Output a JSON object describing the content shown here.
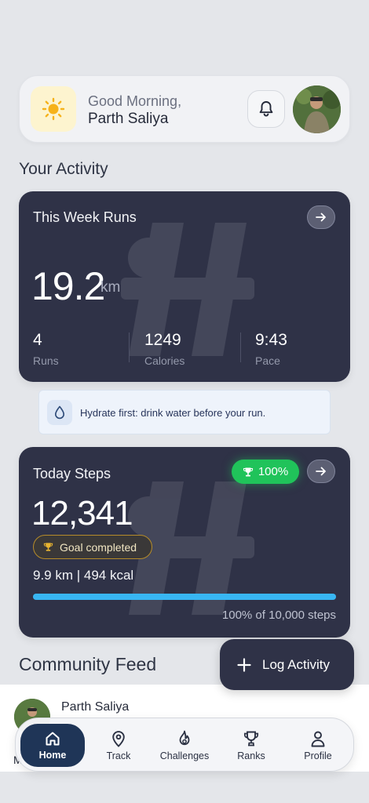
{
  "header": {
    "greeting": "Good Morning,",
    "user_name": "Parth Saliya",
    "weather_icon": "sun-icon",
    "notification_icon": "bell-icon"
  },
  "activity": {
    "section_title": "Your Activity",
    "week_runs": {
      "title": "This Week Runs",
      "distance": "19.2",
      "distance_unit": "km",
      "stats": [
        {
          "value": "4",
          "label": "Runs"
        },
        {
          "value": "1249",
          "label": "Calories"
        },
        {
          "value": "9:43",
          "label": "Pace"
        }
      ]
    }
  },
  "tip": {
    "text": "Hydrate first: drink water before your run.",
    "icon": "water-drop-icon"
  },
  "steps": {
    "title": "Today Steps",
    "percent_badge": "100%",
    "value": "12,341",
    "goal_label": "Goal completed",
    "meta": "9.9 km | 494 kcal",
    "progress_fraction": 1.0,
    "progress_text": "100% of 10,000 steps"
  },
  "community": {
    "section_title": "Community Feed",
    "first_post_name": "Parth Saliya",
    "next_post_initial": "M"
  },
  "fab": {
    "label": "Log Activity"
  },
  "tabs": [
    {
      "label": "Home",
      "icon": "home-icon"
    },
    {
      "label": "Track",
      "icon": "location-pin-icon"
    },
    {
      "label": "Challenges",
      "icon": "flame-icon"
    },
    {
      "label": "Ranks",
      "icon": "trophy-icon"
    },
    {
      "label": "Profile",
      "icon": "person-icon"
    }
  ],
  "colors": {
    "card_dark": "#2f3247",
    "accent_green": "#20c35a",
    "progress_blue": "#38b6f3",
    "tab_active": "#1f3557"
  }
}
